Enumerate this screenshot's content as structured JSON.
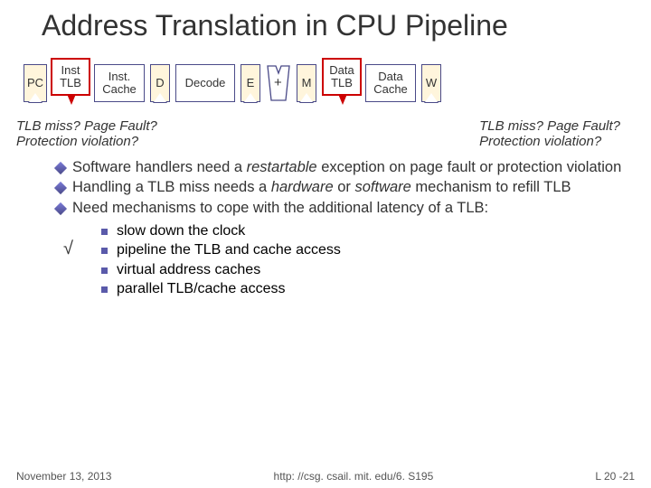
{
  "title": "Address Translation in CPU Pipeline",
  "pipeline": {
    "pc": "PC",
    "inst_tlb_line1": "Inst",
    "inst_tlb_line2": "TLB",
    "inst_cache_line1": "Inst.",
    "inst_cache_line2": "Cache",
    "d": "D",
    "decode": "Decode",
    "e": "E",
    "alu_op": "+",
    "m": "M",
    "data_tlb_line1": "Data",
    "data_tlb_line2": "TLB",
    "data_cache_line1": "Data",
    "data_cache_line2": "Cache",
    "w": "W"
  },
  "questions": {
    "left_line1": "TLB miss? Page Fault?",
    "left_line2": "Protection violation?",
    "right_line1": "TLB miss? Page Fault?",
    "right_line2": "Protection violation?"
  },
  "bullets": [
    {
      "pre": "Software handlers need a ",
      "em": "restartable",
      "post": " exception on page fault or protection violation"
    },
    {
      "pre": "Handling a TLB miss needs a ",
      "em": "hardware",
      "post_em": " or ",
      "em2": "software",
      "post": " mechanism to refill TLB"
    },
    {
      "pre": "Need mechanisms to cope with the additional latency of a TLB:",
      "em": "",
      "post": ""
    }
  ],
  "sub_bullets": [
    "slow down the clock",
    "pipeline the TLB and cache access",
    "virtual address caches",
    "parallel TLB/cache access"
  ],
  "checkmark": "√",
  "footer": {
    "date": "November 13, 2013",
    "url": "http: //csg. csail. mit. edu/6. S195",
    "page": "L 20 -21"
  }
}
